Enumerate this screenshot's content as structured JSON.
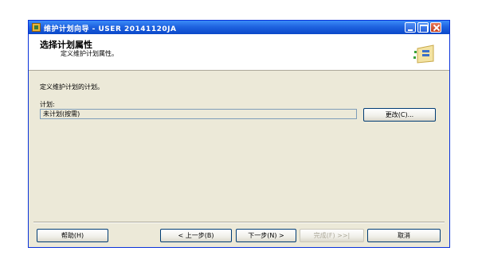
{
  "window": {
    "title": "维护计划向导 - USER 20141120JA"
  },
  "header": {
    "title": "选择计划属性",
    "subtitle": "定义维护计划属性。"
  },
  "body": {
    "description": "定义维护计划的计划。",
    "plan_label": "计划:",
    "plan_value": "未计划(按需)",
    "change_button": "更改(C)..."
  },
  "footer": {
    "help": "帮助(H)",
    "back": "< 上一步(B)",
    "next": "下一步(N) >",
    "finish": "完成(F) >>|",
    "cancel": "取消"
  },
  "colors": {
    "titlebar": "#1f63e0",
    "dialog_bg": "#ece9d8",
    "header_bg": "#ffffff",
    "close_button": "#c23d1c"
  },
  "icons": {
    "app": "app-icon",
    "wizard": "wizard-graphic-icon",
    "minimize": "minimize-icon",
    "maximize": "maximize-icon",
    "close": "close-icon"
  }
}
